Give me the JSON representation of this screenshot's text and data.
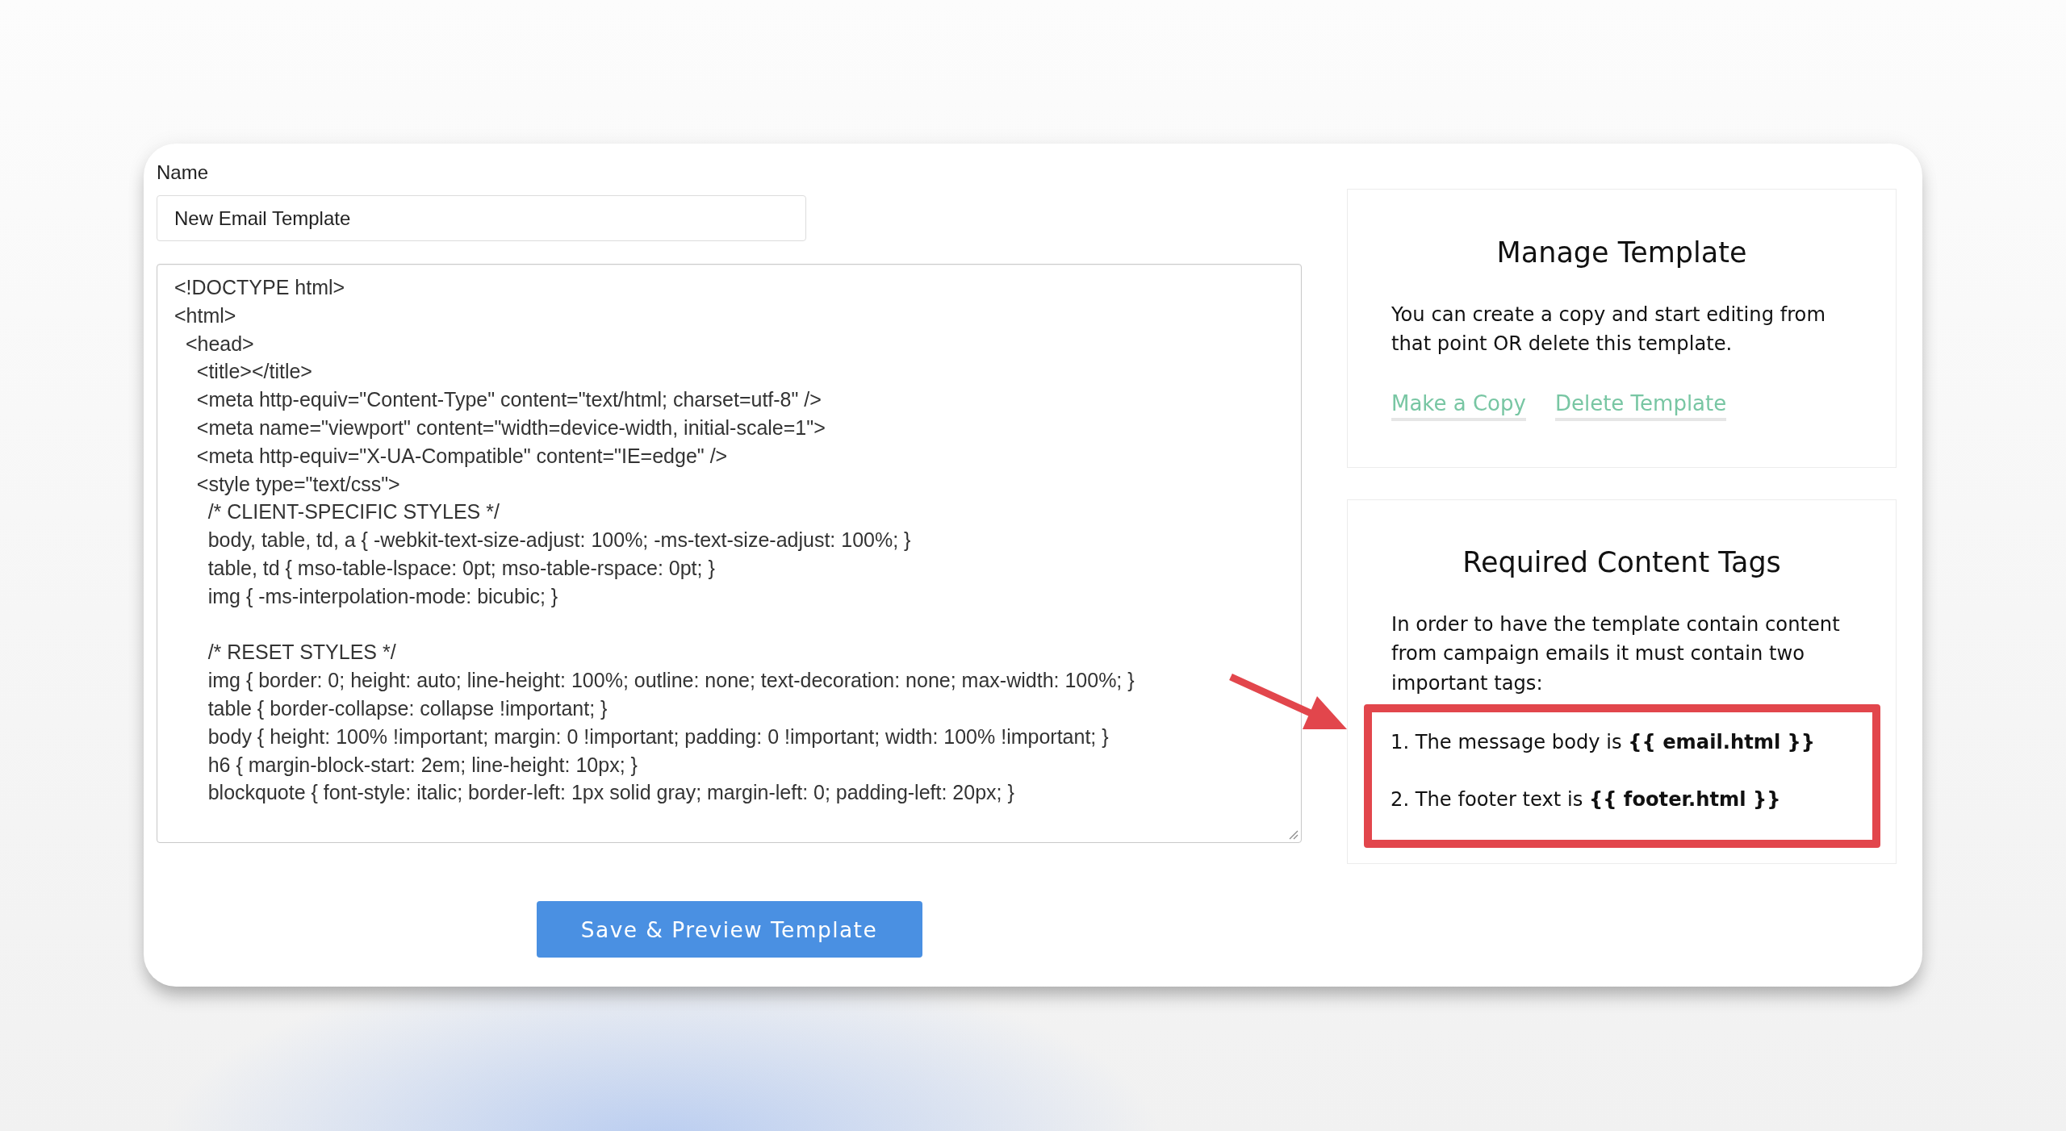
{
  "form": {
    "name_field": {
      "label": "Name",
      "value": "New Email Template"
    },
    "editor": {
      "blocks": [
        {
          "lines": [
            "<!DOCTYPE html>",
            "<html>",
            "  <head>",
            "    <title></title>",
            "    <meta http-equiv=\"Content-Type\" content=\"text/html; charset=utf-8\" />",
            "    <meta name=\"viewport\" content=\"width=device-width, initial-scale=1\">",
            "    <meta http-equiv=\"X-UA-Compatible\" content=\"IE=edge\" />",
            "    <style type=\"text/css\">",
            "      /* CLIENT-SPECIFIC STYLES */",
            "      body, table, td, a { -webkit-text-size-adjust: 100%; -ms-text-size-adjust: 100%; }",
            "      table, td { mso-table-lspace: 0pt; mso-table-rspace: 0pt; }",
            "      img { -ms-interpolation-mode: bicubic; }"
          ]
        },
        {
          "lines": [
            "      /* RESET STYLES */",
            "      img { border: 0; height: auto; line-height: 100%; outline: none; text-decoration: none; max-width: 100%; }",
            "      table { border-collapse: collapse !important; }",
            "      body { height: 100% !important; margin: 0 !important; padding: 0 !important; width: 100% !important; }",
            "      h6 { margin-block-start: 2em; line-height: 10px; }",
            "      blockquote { font-style: italic; border-left: 1px solid gray; margin-left: 0; padding-left: 20px; }"
          ]
        }
      ]
    },
    "save_button": "Save & Preview Template"
  },
  "manage_template": {
    "title": "Manage Template",
    "text": "You can create a copy and start editing from that point OR delete this template.",
    "links": [
      "Make a Copy",
      "Delete Template"
    ]
  },
  "required_tags": {
    "title": "Required Content Tags",
    "text": "In order to have the template contain content from campaign emails it must contain two important tags:",
    "items": [
      "1. The message body is **{{ email.html }}**",
      "2. The footer text is **{{ footer.html }}**"
    ]
  }
}
